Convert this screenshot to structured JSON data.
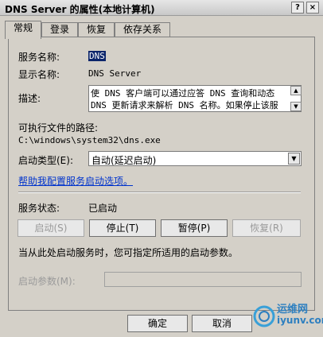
{
  "window": {
    "title": "DNS Server 的属性(本地计算机)",
    "help": "?",
    "close": "×"
  },
  "tabs": [
    {
      "label": "常规",
      "active": true
    },
    {
      "label": "登录",
      "active": false
    },
    {
      "label": "恢复",
      "active": false
    },
    {
      "label": "依存关系",
      "active": false
    }
  ],
  "general": {
    "service_name_label": "服务名称:",
    "service_name_value": "DNS",
    "display_name_label": "显示名称:",
    "display_name_value": "DNS Server",
    "description_label": "描述:",
    "description_line1": "使 DNS 客户端可以通过应答 DNS 查询和动态",
    "description_line2": "DNS 更新请求来解析 DNS 名称。如果停止该服",
    "exec_path_label": "可执行文件的路径:",
    "exec_path_value": "C:\\windows\\system32\\dns.exe",
    "startup_type_label": "启动类型(E):",
    "startup_type_value": "自动(延迟启动)",
    "help_link": "帮助我配置服务启动选项。",
    "service_status_label": "服务状态:",
    "service_status_value": "已启动",
    "buttons": {
      "start": "启动(S)",
      "stop": "停止(T)",
      "pause": "暂停(P)",
      "resume": "恢复(R)"
    },
    "start_hint": "当从此处启动服务时，您可指定所适用的启动参数。",
    "start_params_label": "启动参数(M):",
    "start_params_value": ""
  },
  "footer": {
    "ok": "确定",
    "cancel": "取消"
  },
  "watermark": {
    "line1": "运维网",
    "line2": "iyunv.com"
  }
}
